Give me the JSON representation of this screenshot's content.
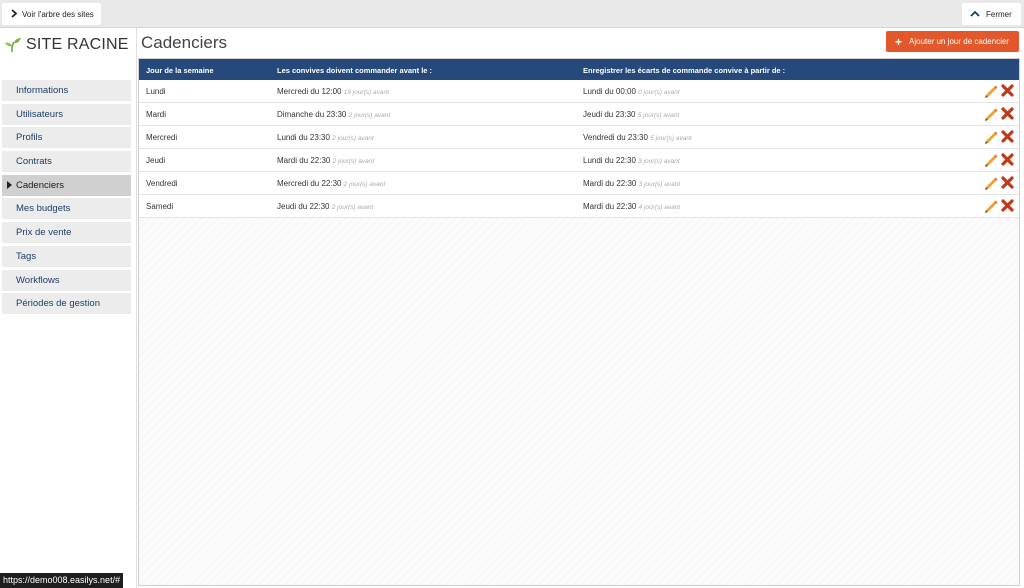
{
  "topbar": {
    "tree_label": "Voir l'arbre des sites",
    "close_label": "Fermer"
  },
  "sidebar": {
    "logo_text": "SITE RACINE",
    "items": [
      {
        "label": "Informations"
      },
      {
        "label": "Utilisateurs"
      },
      {
        "label": "Profils"
      },
      {
        "label": "Contrats"
      },
      {
        "label": "Cadenciers",
        "active": true
      },
      {
        "label": "Mes budgets"
      },
      {
        "label": "Prix de vente"
      },
      {
        "label": "Tags"
      },
      {
        "label": "Workflows"
      },
      {
        "label": "Périodes de gestion"
      }
    ]
  },
  "main": {
    "title": "Cadenciers",
    "add_button_label": "Ajouter un jour de cadencier",
    "table": {
      "headers": [
        "Jour de la semaine",
        "Les convives doivent commander avant le :",
        "Enregistrer les écarts de commande convive à partir de :"
      ],
      "rows": [
        {
          "day": "Lundi",
          "order": "Mercredi du 12:00",
          "order_note": "19 jour(s) avant",
          "record": "Lundi du 00:00",
          "record_note": "0 jour(s) avant"
        },
        {
          "day": "Mardi",
          "order": "Dimanche du 23:30",
          "order_note": "2 jour(s) avant",
          "record": "Jeudi du 23:30",
          "record_note": "5 jour(s) avant"
        },
        {
          "day": "Mercredi",
          "order": "Lundi du 23:30",
          "order_note": "2 jour(s) avant",
          "record": "Vendredi du 23:30",
          "record_note": "5 jour(s) avant"
        },
        {
          "day": "Jeudi",
          "order": "Mardi du 22:30",
          "order_note": "2 jour(s) avant",
          "record": "Lundi du 22:30",
          "record_note": "3 jour(s) avant"
        },
        {
          "day": "Vendredi",
          "order": "Mercredi du 22:30",
          "order_note": "2 jour(s) avant",
          "record": "Mardi du 22:30",
          "record_note": "3 jour(s) avant"
        },
        {
          "day": "Samedi",
          "order": "Jeudi du 22:30",
          "order_note": "2 jour(s) avant",
          "record": "Mardi du 22:30",
          "record_note": "4 jour(s) avant"
        }
      ]
    }
  },
  "status_url": "https://demo008.easilys.net/#",
  "colors": {
    "header_bg": "#25497a",
    "accent_orange": "#e3582b",
    "edit_icon": "#f0a030",
    "delete_icon": "#c0391b"
  },
  "icons": {
    "tree_button": "chevron-right-icon",
    "close_button": "chevron-up-icon",
    "logo": "sprout-icon",
    "add_button": "plus-icon",
    "row_edit": "pencil-icon",
    "row_delete": "delete-x-icon"
  }
}
